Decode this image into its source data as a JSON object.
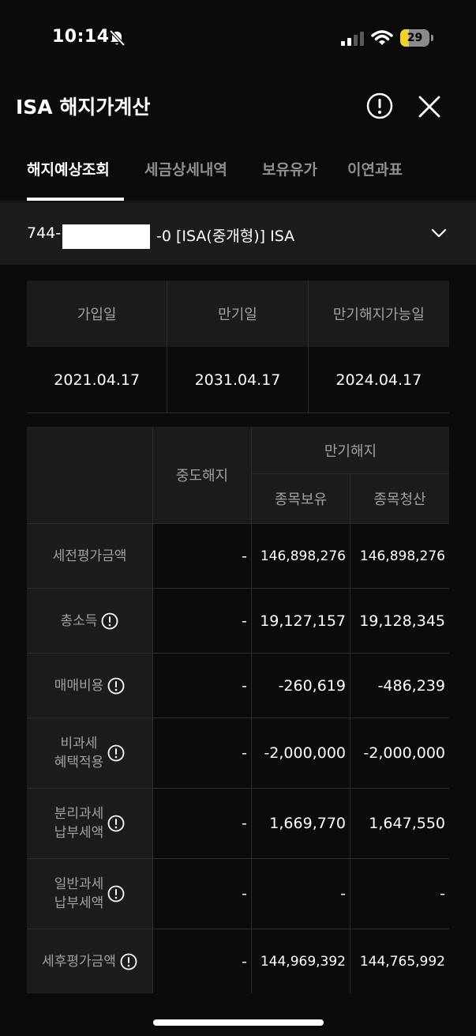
{
  "status_bar": {
    "time": "10:14",
    "battery_level": "29"
  },
  "header": {
    "title": "ISA 해지가계산"
  },
  "tabs": [
    {
      "label": "해지예상조회",
      "active": true
    },
    {
      "label": "세금상세내역",
      "active": false
    },
    {
      "label": "보유유가",
      "active": false
    },
    {
      "label": "이연과표",
      "active": false
    }
  ],
  "account": {
    "prefix": "744-",
    "suffix": "-0 [ISA(중개형)] ISA"
  },
  "summary": {
    "headers": [
      "가입일",
      "만기일",
      "만기해지가능일"
    ],
    "values": [
      "2021.04.17",
      "2031.04.17",
      "2024.04.17"
    ]
  },
  "detail": {
    "col_midterm": "중도해지",
    "col_group": "만기해지",
    "col_hold": "종목보유",
    "col_liquidate": "종목청산",
    "rows": [
      {
        "label": "세전평가금액",
        "midterm": "-",
        "hold": "146,898,276",
        "liquidate": "146,898,276"
      },
      {
        "label": "총소득",
        "midterm": "-",
        "hold": "19,127,157",
        "liquidate": "19,128,345"
      },
      {
        "label": "매매비용",
        "midterm": "-",
        "hold": "-260,619",
        "liquidate": "-486,239"
      },
      {
        "label_line1": "비과세",
        "label_line2": "혜택적용",
        "midterm": "-",
        "hold": "-2,000,000",
        "liquidate": "-2,000,000"
      },
      {
        "label_line1": "분리과세",
        "label_line2": "납부세액",
        "midterm": "-",
        "hold": "1,669,770",
        "liquidate": "1,647,550"
      },
      {
        "label_line1": "일반과세",
        "label_line2": "납부세액",
        "midterm": "-",
        "hold": "-",
        "liquidate": "-"
      },
      {
        "label": "세후평가금액",
        "midterm": "-",
        "hold": "144,969,392",
        "liquidate": "144,765,992"
      }
    ]
  }
}
